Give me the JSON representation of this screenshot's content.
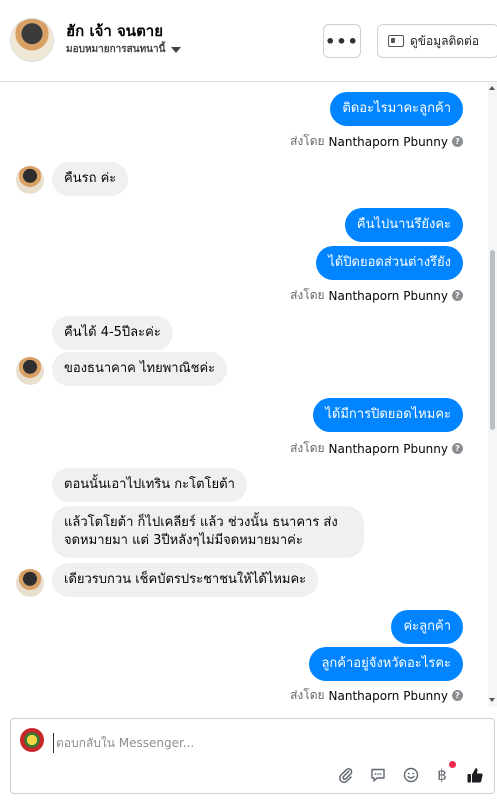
{
  "header": {
    "name": "ฮัก เจ้า จนตาย",
    "subtitle": "มอบหมายการสนทนานี้",
    "more_label": "•••",
    "contact_label": "ดูข้อมูลติดต่อ"
  },
  "messages": {
    "m1": "ติดอะไรมาคะลูกค้า",
    "sent1_prefix": "ส่งโดย",
    "sent1_name": "Nanthaporn Pbunny",
    "m2": "คืนรถ ค่ะ",
    "m3": "คืนไปนานรึยังคะ",
    "m4": "ได้ปิดยอดส่วนต่างรึยัง",
    "sent2_prefix": "ส่งโดย",
    "sent2_name": "Nanthaporn Pbunny",
    "m5": "คืนได้ 4-5ปีละค่ะ",
    "m6": "ของธนาคาค ไทยพาณิชค่ะ",
    "m7": "ได้มีการปิดยอดไหมคะ",
    "sent3_prefix": "ส่งโดย",
    "sent3_name": "Nanthaporn Pbunny",
    "m8": "ตอนนั้นเอาไปเทริน กะโตโยต้า",
    "m9": "แล้วโตโยต้า ก็ไปเคลียร์ แล้ว ช่วงนั้น ธนาคาร ส่ง จดหมายมา แต่ 3ปีหลังๆไม่มีจดหมายมาค่ะ",
    "m10": "เดียวรบกวน เช็คบัตรประชาชนให้ได้ไหมคะ",
    "m11": "ค่ะลูกค้า",
    "m12": "ลูกค้าอยู่จังหวัดอะไรคะ",
    "sent4_prefix": "ส่งโดย",
    "sent4_name": "Nanthaporn Pbunny"
  },
  "composer": {
    "placeholder": "ตอบกลับใน Messenger..."
  },
  "icons": {
    "attach": "paperclip-icon",
    "chat": "speech-bubble-icon",
    "emoji": "smiley-icon",
    "payment": "baht-icon",
    "like": "thumbs-up-icon"
  },
  "colors": {
    "outgoing": "#0084ff",
    "incoming": "#f0f0f0",
    "like": "#1c1e21"
  }
}
